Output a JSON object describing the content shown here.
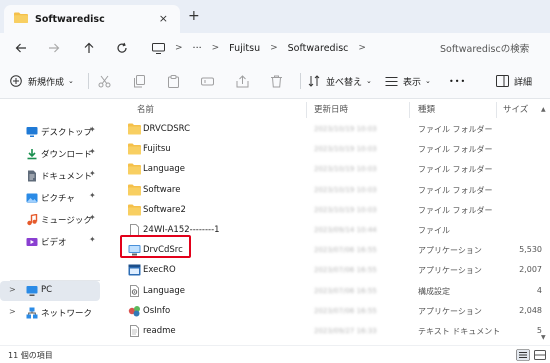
{
  "window": {
    "tab_title": "Softwaredisc",
    "tab_close_glyph": "×",
    "new_tab_glyph": "+"
  },
  "navigation": {
    "breadcrumb": [
      "Fujitsu",
      "Softwaredisc"
    ],
    "more_glyph": "···",
    "separator_glyph": ">",
    "search_placeholder": "Softwarediscの検索"
  },
  "toolbar": {
    "new_label": "新規作成",
    "sort_label": "並べ替え",
    "view_label": "表示",
    "more_glyph": "•••",
    "details_label": "詳細"
  },
  "sidebar": {
    "quick_access": [
      {
        "label": "デスクトップ",
        "icon": "desktop-icon",
        "color": "#1f7ad6"
      },
      {
        "label": "ダウンロード",
        "icon": "download-icon",
        "color": "#1a8f4f"
      },
      {
        "label": "ドキュメント",
        "icon": "document-icon",
        "color": "#5f6b7a"
      },
      {
        "label": "ピクチャ",
        "icon": "picture-icon",
        "color": "#2b8be6"
      },
      {
        "label": "ミュージック",
        "icon": "music-icon",
        "color": "#e65a2b"
      },
      {
        "label": "ビデオ",
        "icon": "video-icon",
        "color": "#8a3fd1"
      }
    ],
    "pin_glyph": "📌",
    "pc_label": "PC",
    "network_label": "ネットワーク",
    "expander_glyph": ">"
  },
  "columns": {
    "name": "名前",
    "date": "更新日時",
    "type": "種類",
    "size": "サイズ"
  },
  "files": [
    {
      "name": "DRVCDSRC",
      "date": "2023/10/19 10:03",
      "type": "ファイル フォルダー",
      "size": "",
      "icon": "folder-icon"
    },
    {
      "name": "Fujitsu",
      "date": "2023/10/19 10:03",
      "type": "ファイル フォルダー",
      "size": "",
      "icon": "folder-icon"
    },
    {
      "name": "Language",
      "date": "2023/10/19 10:03",
      "type": "ファイル フォルダー",
      "size": "",
      "icon": "folder-icon"
    },
    {
      "name": "Software",
      "date": "2023/10/19 10:03",
      "type": "ファイル フォルダー",
      "size": "",
      "icon": "folder-icon"
    },
    {
      "name": "Software2",
      "date": "2023/10/19 10:03",
      "type": "ファイル フォルダー",
      "size": "",
      "icon": "folder-icon"
    },
    {
      "name": "24WI-A152--------1",
      "date": "2023/09/14 10:44",
      "type": "ファイル",
      "size": "",
      "icon": "file-icon"
    },
    {
      "name": "DrvCdSrc",
      "date": "2023/07/06 16:55",
      "type": "アプリケーション",
      "size": "5,530",
      "icon": "app-drvcd-icon"
    },
    {
      "name": "ExecRO",
      "date": "2023/07/06 16:55",
      "type": "アプリケーション",
      "size": "2,007",
      "icon": "app-exec-icon"
    },
    {
      "name": "Language",
      "date": "2023/07/06 16:55",
      "type": "構成設定",
      "size": "4",
      "icon": "config-icon"
    },
    {
      "name": "OsInfo",
      "date": "2023/07/06 16:55",
      "type": "アプリケーション",
      "size": "2,048",
      "icon": "app-osinfo-icon"
    },
    {
      "name": "readme",
      "date": "2023/09/27 16:33",
      "type": "テキスト ドキュメント",
      "size": "5",
      "icon": "text-file-icon"
    }
  ],
  "status": {
    "item_count": "11 個の項目"
  },
  "colors": {
    "folder": "#f5c04a",
    "highlight_border": "#e2001a",
    "accent": "#1f7ad6"
  }
}
